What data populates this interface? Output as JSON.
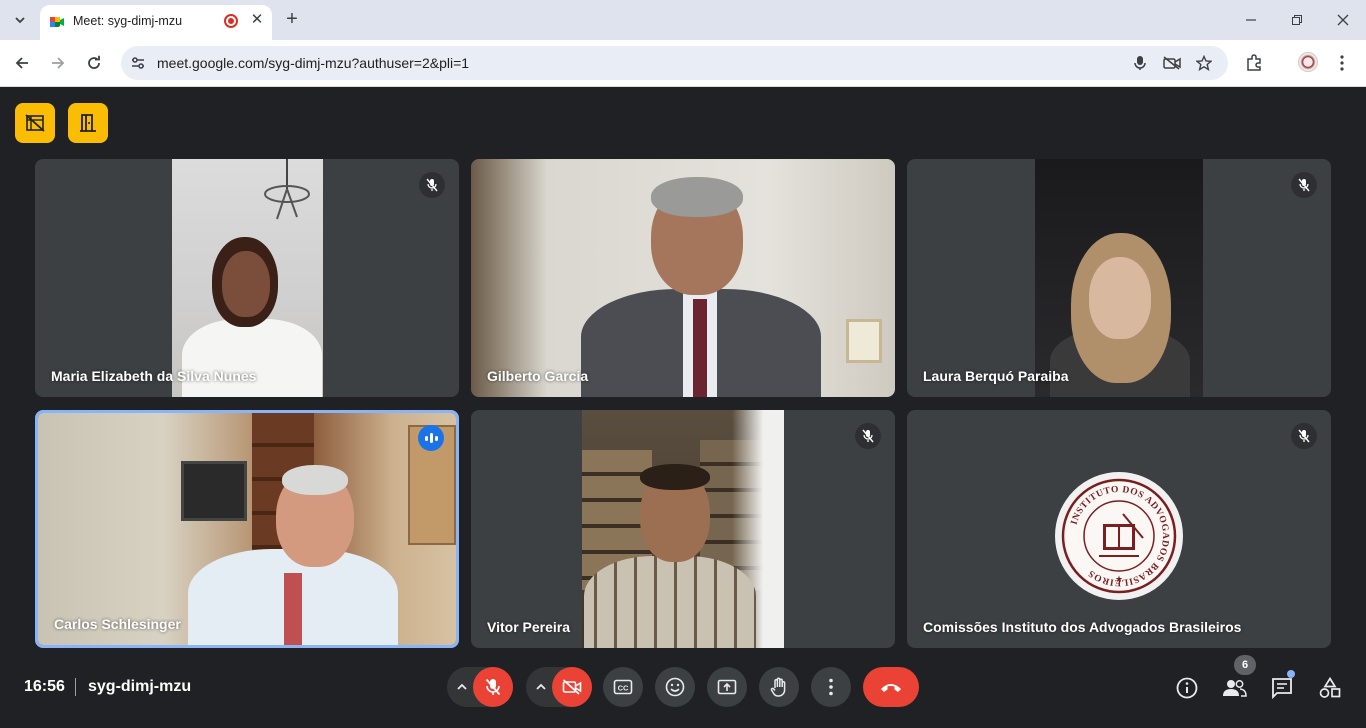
{
  "browser": {
    "tab_title": "Meet: syg-dimj-mzu",
    "url": "meet.google.com/syg-dimj-mzu?authuser=2&pli=1"
  },
  "participants": [
    {
      "name": "Maria Elizabeth da Silva Nunes",
      "muted": true
    },
    {
      "name": "Gilberto Garcia",
      "muted": false
    },
    {
      "name": "Laura Berquó Paraiba",
      "muted": true
    },
    {
      "name": "Carlos Schlesinger",
      "muted": false,
      "speaking": true
    },
    {
      "name": "Vitor Pereira",
      "muted": true
    },
    {
      "name": "Comissões Instituto dos Advogados Brasileiros",
      "muted": true
    }
  ],
  "logo_text": "INSTITUTO DOS ADVOGADOS BRASILEIROS",
  "bottom": {
    "time": "16:56",
    "meeting_code": "syg-dimj-mzu",
    "people_count": "6"
  },
  "colors": {
    "background": "#202124",
    "tile": "#3c4043",
    "accent_yellow": "#fbbc04",
    "end_call_red": "#ea4335",
    "speaking_border": "#8ab4f8"
  }
}
